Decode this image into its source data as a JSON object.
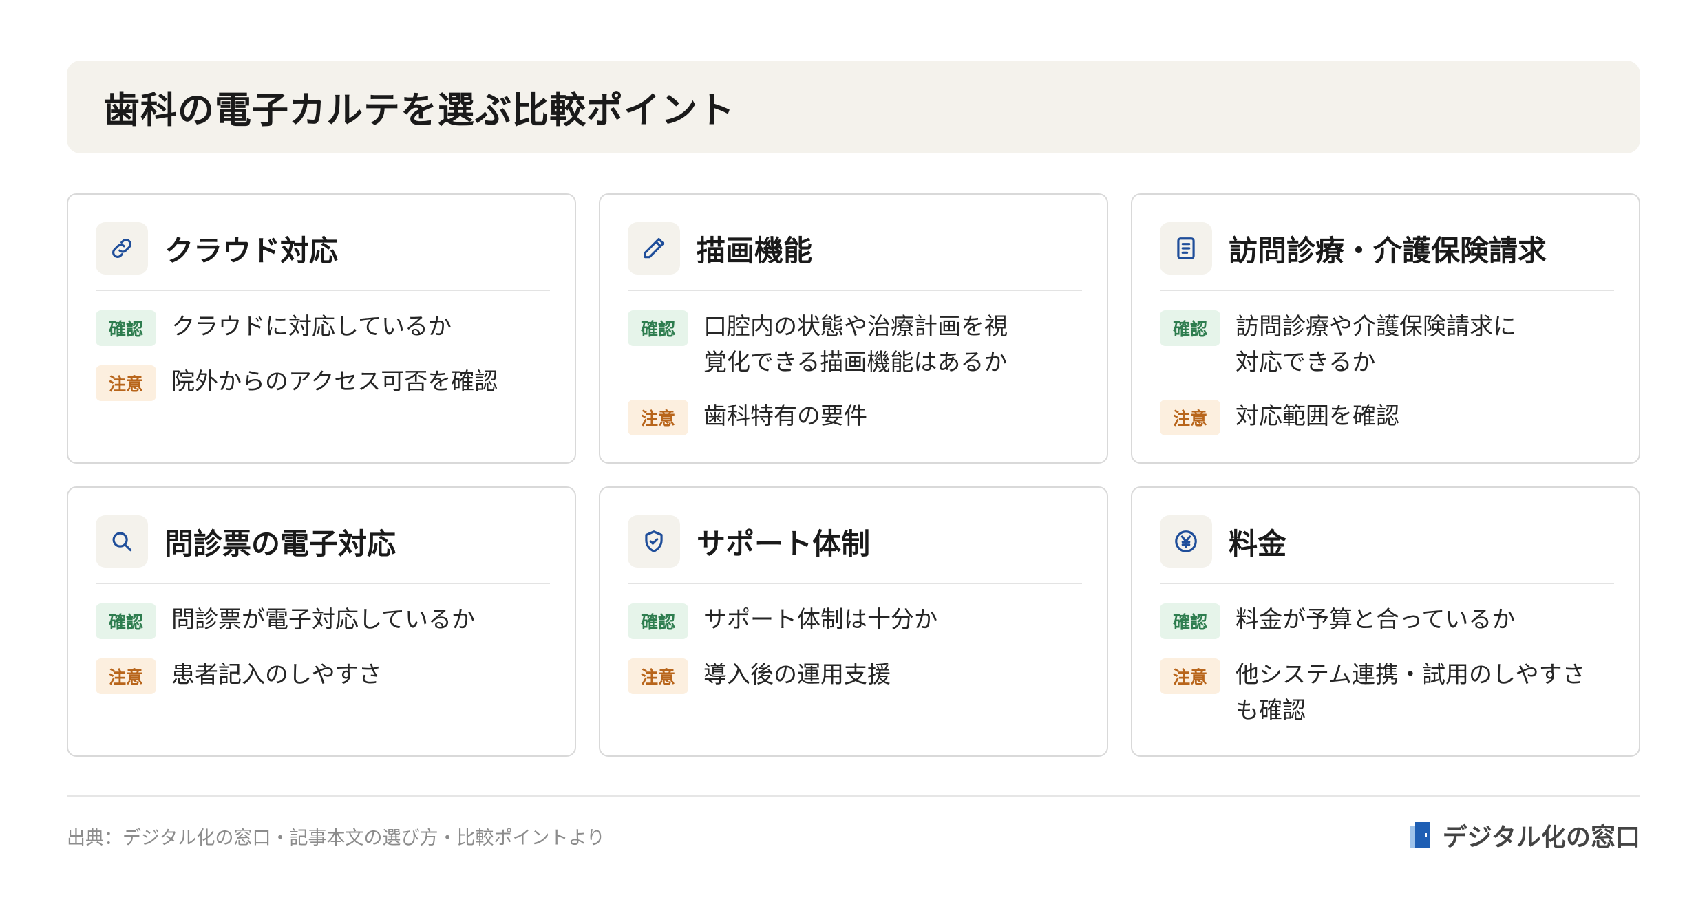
{
  "title": "歯科の電子カルテを選ぶ比較ポイント",
  "colors": {
    "accent_icon": "#1f4e9a",
    "check_badge_bg": "#e6f4ea",
    "check_badge_text": "#2e7d4f",
    "warn_badge_bg": "#fcefdf",
    "warn_badge_text": "#b8651b",
    "header_bg": "#f4f2ec"
  },
  "cards": [
    {
      "icon": "link-icon",
      "title": "クラウド対応",
      "rows": [
        {
          "badge": "確認",
          "text": "クラウドに対応しているか"
        },
        {
          "badge": "注意",
          "text": "院外からのアクセス可否を確認"
        }
      ]
    },
    {
      "icon": "pencil-icon",
      "title": "描画機能",
      "rows": [
        {
          "badge": "確認",
          "text": "口腔内の状態や治療計画を視覚化できる描画機能はあるか"
        },
        {
          "badge": "注意",
          "text": "歯科特有の要件"
        }
      ]
    },
    {
      "icon": "document-icon",
      "title": "訪問診療・介護保険請求",
      "rows": [
        {
          "badge": "確認",
          "text": "訪問診療や介護保険請求に対応できるか"
        },
        {
          "badge": "注意",
          "text": "対応範囲を確認"
        }
      ]
    },
    {
      "icon": "search-icon",
      "title": "問診票の電子対応",
      "rows": [
        {
          "badge": "確認",
          "text": "問診票が電子対応しているか"
        },
        {
          "badge": "注意",
          "text": "患者記入のしやすさ"
        }
      ]
    },
    {
      "icon": "shield-check-icon",
      "title": "サポート体制",
      "rows": [
        {
          "badge": "確認",
          "text": "サポート体制は十分か"
        },
        {
          "badge": "注意",
          "text": "導入後の運用支援"
        }
      ]
    },
    {
      "icon": "yen-icon",
      "title": "料金",
      "rows": [
        {
          "badge": "確認",
          "text": "料金が予算と合っているか"
        },
        {
          "badge": "注意",
          "text": "他システム連携・試用のしやすさも確認"
        }
      ]
    }
  ],
  "footer": {
    "source": "出典：デジタル化の窓口・記事本文の選び方・比較ポイントより",
    "brand": "デジタル化の窓口"
  }
}
